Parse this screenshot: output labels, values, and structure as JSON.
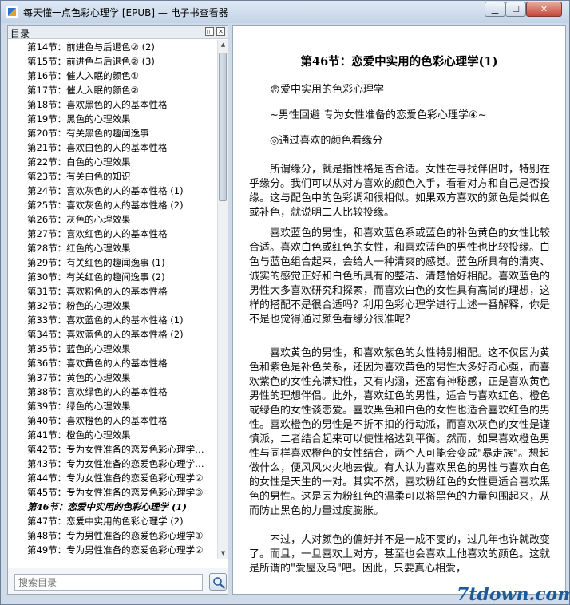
{
  "window": {
    "title": "每天懂一点色彩心理学 [EPUB] — 电子书查看器",
    "btn_min": "▁",
    "btn_max": "☐",
    "btn_close": "✕"
  },
  "toc": {
    "title": "目录",
    "items": [
      "第14节：前进色与后退色② (2)",
      "第15节：前进色与后退色② (3)",
      "第16节：催人入眠的颜色①",
      "第17节：催人入眠的颜色②",
      "第18节：喜欢黑色的人的基本性格",
      "第19节：黑色的心理效果",
      "第20节：有关黑色的趣闻逸事",
      "第21节：喜欢白色的人的基本性格",
      "第22节：白色的心理效果",
      "第23节：有关白色的知识",
      "第24节：喜欢灰色的人的基本性格 (1)",
      "第25节：喜欢灰色的人的基本性格 (2)",
      "第26节：灰色的心理效果",
      "第27节：喜欢红色的人的基本性格",
      "第28节：红色的心理效果",
      "第29节：有关红色的趣闻逸事 (1)",
      "第30节：有关红色的趣闻逸事 (2)",
      "第31节：喜欢粉色的人的基本性格",
      "第32节：粉色的心理效果",
      "第33节：喜欢蓝色的人的基本性格 (1)",
      "第34节：喜欢蓝色的人的基本性格 (2)",
      "第35节：蓝色的心理效果",
      "第36节：喜欢黄色的人的基本性格",
      "第37节：黄色的心理效果",
      "第38节：喜欢绿色的人的基本性格",
      "第39节：绿色的心理效果",
      "第40节：喜欢橙色的人的基本性格",
      "第41节：橙色的心理效果",
      "第42节：专为女性准备的恋爱色彩心理学…",
      "第43节：专为女性准备的恋爱色彩心理学…",
      "第44节：专为女性准备的恋爱色彩心理学②",
      "第45节：专为女性准备的恋爱色彩心理学③",
      "第46节：恋爱中实用的色彩心理学 (1)",
      "第47节：恋爱中实用的色彩心理学 (2)",
      "第48节：专为男性准备的恋爱色彩心理学①",
      "第49节：专为男性准备的恋爱色彩心理学②"
    ],
    "active_index": 32,
    "search_placeholder": "搜索目录"
  },
  "reader": {
    "chapter_title": "第46节：恋爱中实用的色彩心理学(1)",
    "sub1": "恋爱中实用的色彩心理学",
    "sub2": "~男性回避 专为女性准备的恋爱色彩心理学④~",
    "sub3": "◎通过喜欢的颜色看缘分",
    "p1": "所谓缘分，就是指性格是否合适。女性在寻找伴侣时，特别在乎缘分。我们可以从对方喜欢的颜色入手，看看对方和自己是否投缘。这与配色中的色彩调和很相似。如果双方喜欢的颜色是类似色或补色，就说明二人比较投缘。",
    "p2": "喜欢蓝色的男性，和喜欢蓝色系或蓝色的补色黄色的女性比较合适。喜欢白色或红色的女性，和喜欢蓝色的男性也比较投缘。白色与蓝色组合起来，会给人一种清爽的感觉。蓝色所具有的清爽、诚实的感觉正好和白色所具有的整洁、清楚恰好相配。喜欢蓝色的男性大多喜欢研究和探索，而喜欢白色的女性具有高尚的理想，这样的搭配不是很合适吗？利用色彩心理学进行上述一番解释，你是不是也觉得通过颜色看缘分很准呢？",
    "p3": "喜欢黄色的男性，和喜欢紫色的女性特别相配。这不仅因为黄色和紫色是补色关系，还因为喜欢黄色的男性大多好奇心强，而喜欢紫色的女性充满知性，又有内涵，还富有神秘感，正是喜欢黄色男性的理想伴侣。此外，喜欢红色的男性，适合与喜欢红色、橙色或绿色的女性谈恋爱。喜欢黑色和白色的女性也适合喜欢红色的男性。喜欢橙色的男性是不折不扣的行动派，而喜欢灰色的女性是谨慎派，二者结合起来可以使性格达到平衡。然而，如果喜欢橙色男性与同样喜欢橙色的女性结合，两个人可能会变成\"暴走族\"。想起做什么，便风风火火地去做。有人认为喜欢黑色的男性与喜欢白色的女性是天生的一对。其实不然，喜欢粉红色的女性更适合喜欢黑色的男性。这是因为粉红色的温柔可以将黑色的力量包围起来，从而防止黑色的力量过度膨胀。",
    "p4": "不过，人对颜色的偏好并不是一成不变的，过几年也许就改变了。而且，一旦喜欢上对方，甚至也会喜欢上他喜欢的颜色。这就是所谓的\"爱屋及乌\"吧。因此，只要真心相爱，"
  },
  "watermark": "7tdown.com"
}
